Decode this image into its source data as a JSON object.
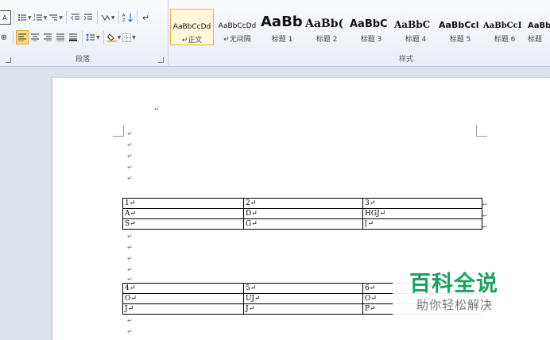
{
  "ribbon": {
    "paragraph_group_label": "段落",
    "styles_group_label": "样式",
    "styles": [
      {
        "sample": "AaBbCcDd",
        "name": "↵正文"
      },
      {
        "sample": "AaBbCcDd",
        "name": "↵无间隔"
      },
      {
        "sample": "AaBb",
        "name": "标题 1"
      },
      {
        "sample": "AaBb(",
        "name": "标题 2"
      },
      {
        "sample": "AaBbC",
        "name": "标题 3"
      },
      {
        "sample": "AaBbC",
        "name": "标题 4"
      },
      {
        "sample": "AaBbCcl",
        "name": "标题 5"
      },
      {
        "sample": "AaBbCcI",
        "name": "标题 6"
      },
      {
        "sample": "AaBb",
        "name": "标题"
      }
    ],
    "highlight_color": "#fbd982",
    "font_color_swatch": "#f0c000"
  },
  "document": {
    "paragraph_mark": "↵",
    "table1": [
      [
        "1↵",
        "2↵",
        "3↵"
      ],
      [
        "A↵",
        "D↵",
        "HGJ↵"
      ],
      [
        "S↵",
        "G↵",
        "[↵"
      ]
    ],
    "table2": [
      [
        "4↵",
        "5↵",
        "6↵"
      ],
      [
        "O↵",
        "UJ↵",
        "O↵"
      ],
      [
        "J↵",
        "J↵",
        "P↵"
      ]
    ]
  },
  "watermark": {
    "title": "百科全说",
    "subtitle": "助你轻松解决",
    "color": "#1aa260"
  }
}
